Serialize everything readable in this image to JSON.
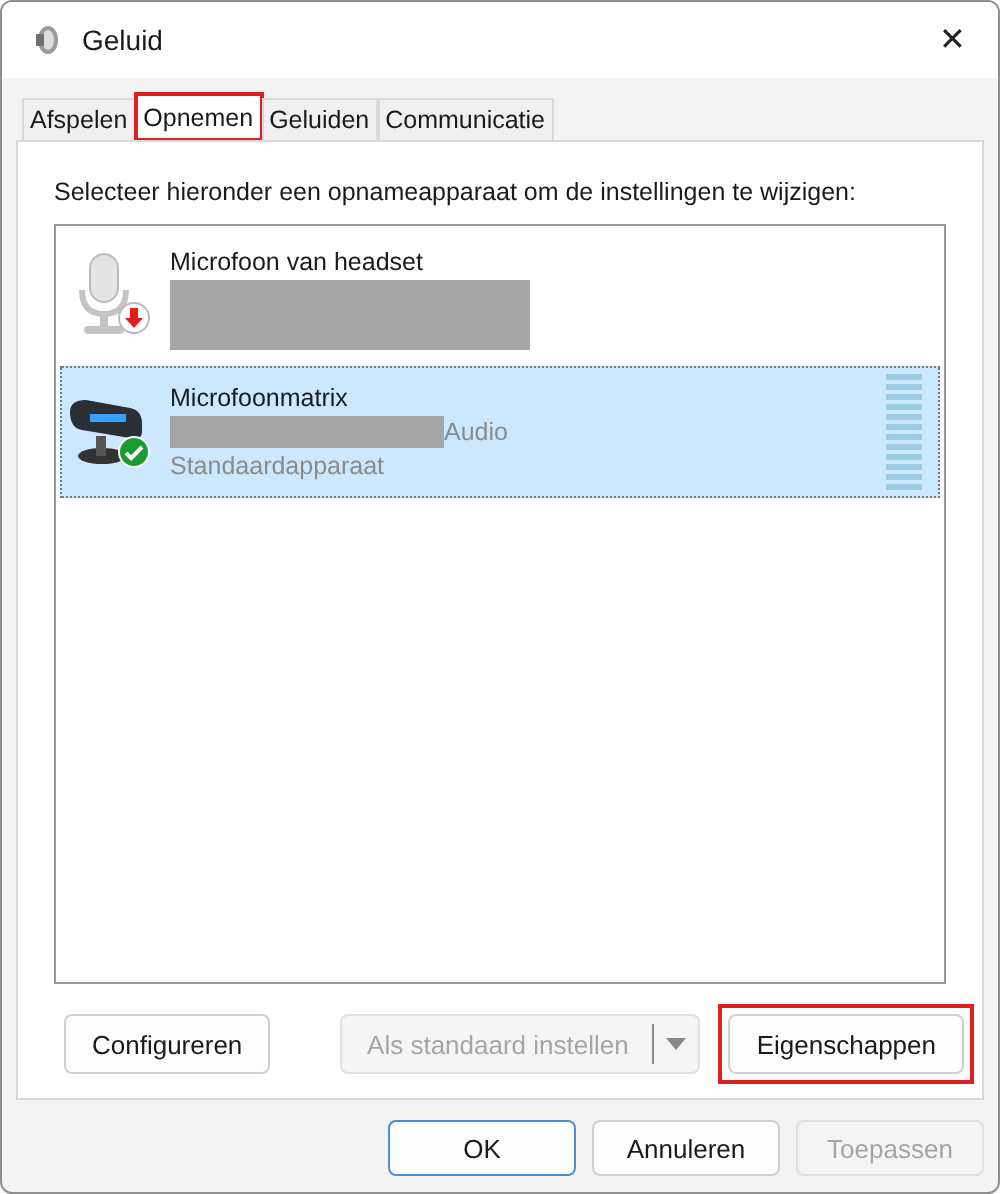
{
  "window": {
    "title": "Geluid",
    "close": "✕"
  },
  "tabs": [
    {
      "label": "Afspelen",
      "selected": false,
      "highlighted": false
    },
    {
      "label": "Opnemen",
      "selected": true,
      "highlighted": true
    },
    {
      "label": "Geluiden",
      "selected": false,
      "highlighted": false
    },
    {
      "label": "Communicatie",
      "selected": false,
      "highlighted": false
    }
  ],
  "instruction": "Selecteer hieronder een opnameapparaat om de instellingen te wijzigen:",
  "devices": [
    {
      "name": "Microfoon van headset",
      "kind": "headset",
      "unplugged": true,
      "default_device": false,
      "selected": false,
      "redacted": true
    },
    {
      "name": "Microfoonmatrix",
      "kind": "array",
      "unplugged": false,
      "default_device": true,
      "selected": true,
      "redacted": true,
      "detail": "Audio",
      "status": "Standaardapparaat"
    }
  ],
  "actions": [
    {
      "label": "Configureren",
      "disabled": false,
      "split": false,
      "highlighted": false
    },
    {
      "label": "Als standaard instellen",
      "disabled": true,
      "split": true,
      "highlighted": false
    },
    {
      "label": "Eigenschappen",
      "disabled": false,
      "split": false,
      "highlighted": true
    }
  ],
  "dialog_buttons": [
    {
      "label": "OK",
      "default": true,
      "disabled": false
    },
    {
      "label": "Annuleren",
      "default": false,
      "disabled": false
    },
    {
      "label": "Toepassen",
      "default": false,
      "disabled": true
    }
  ]
}
